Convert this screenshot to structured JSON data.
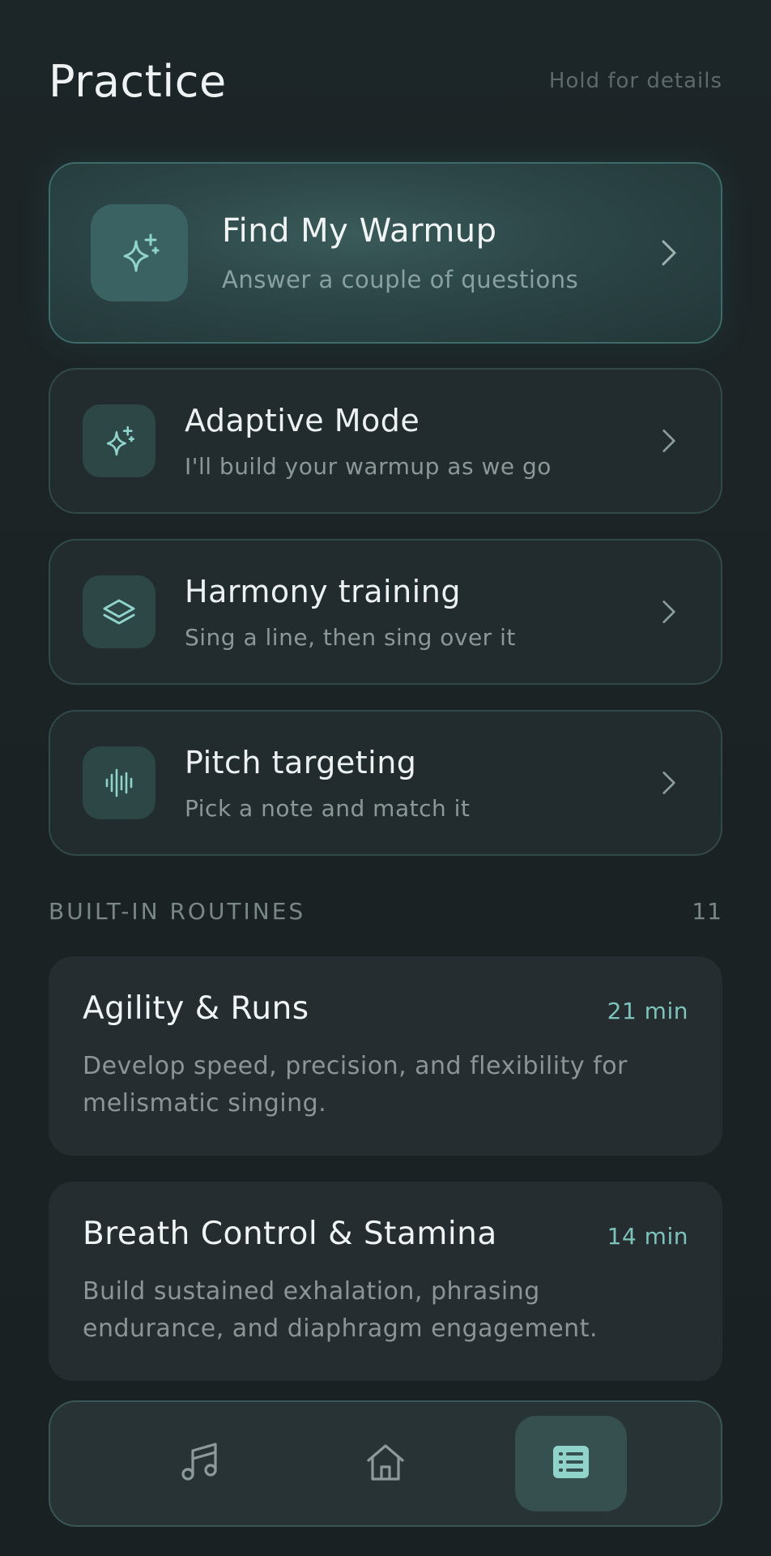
{
  "header": {
    "title": "Practice",
    "hint": "Hold for details"
  },
  "featured": {
    "title": "Find My Warmup",
    "subtitle": "Answer a couple of questions",
    "icon": "sparkles-icon"
  },
  "options": [
    {
      "title": "Adaptive Mode",
      "subtitle": "I'll build your warmup as we go",
      "icon": "sparkles-icon"
    },
    {
      "title": "Harmony training",
      "subtitle": "Sing a line, then sing over it",
      "icon": "layers-icon"
    },
    {
      "title": "Pitch targeting",
      "subtitle": "Pick a note and match it",
      "icon": "waveform-icon"
    }
  ],
  "section": {
    "label": "BUILT-IN ROUTINES",
    "count": "11"
  },
  "routines": [
    {
      "title": "Agility & Runs",
      "duration": "21 min",
      "description": "Develop speed, precision, and flexibility for melismatic singing."
    },
    {
      "title": "Breath Control & Stamina",
      "duration": "14 min",
      "description": "Build sustained exhalation, phrasing endurance, and diaphragm engagement."
    }
  ],
  "tabbar": {
    "tabs": [
      {
        "icon": "music-note-icon",
        "active": false
      },
      {
        "icon": "home-icon",
        "active": false
      },
      {
        "icon": "list-icon",
        "active": true
      }
    ]
  },
  "colors": {
    "accent": "#7ec3bb",
    "background": "#1c2426",
    "card": "#222c2e"
  }
}
